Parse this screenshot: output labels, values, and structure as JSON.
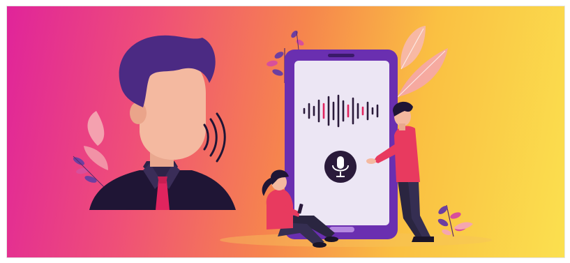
{
  "illustration": {
    "subject": "",
    "colors": {
      "gradient_start": "#e0249a",
      "gradient_mid": "#f6854d",
      "gradient_end": "#fbe04f",
      "phone_body": "#6a2fb0",
      "phone_screen": "#ece6f4",
      "mic_button": "#2a1a3a",
      "hair": "#4b2a83",
      "skin": "#f4b9a0",
      "suit": "#1f1535",
      "tie": "#e0245e",
      "shirt_red": "#e83a5f",
      "pants": "#2a2540"
    },
    "icons": [
      "microphone-icon",
      "sound-wave-icon",
      "voice-waves-icon"
    ]
  }
}
